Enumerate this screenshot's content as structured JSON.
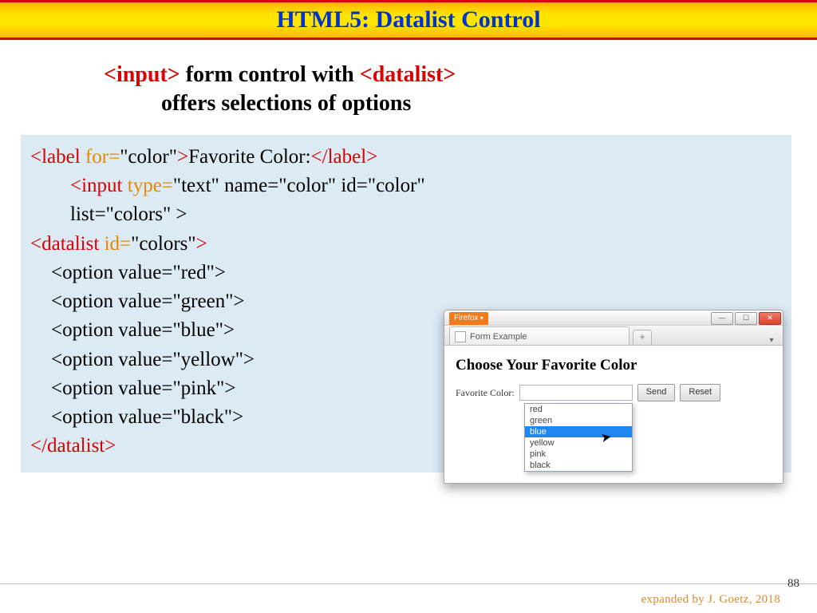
{
  "title": "HTML5: Datalist Control",
  "subtitle": {
    "tag_input": "<input>",
    "middle": " form control with ",
    "tag_datalist": "<datalist>",
    "line2": "offers selections of options"
  },
  "code": {
    "line1": {
      "open": "<label ",
      "attr": "for=",
      "val": "\"color\"",
      "close": ">",
      "text": "Favorite Color:",
      "end": "</label>"
    },
    "line2_a": "<input ",
    "line2_type_key": "type=",
    "line2_type_val": "\"text\"",
    "line2_rest_a": " name=\"color\" id=\"color\" ",
    "line3": "list=\"colors\" >",
    "line4_open": "<datalist ",
    "line4_attr": "id=",
    "line4_val": "\"colors\"",
    "line4_close": ">",
    "options": [
      "<option value=\"red\">",
      "<option value=\"green\">",
      "<option value=\"blue\">",
      "<option value=\"yellow\">",
      "<option value=\"pink\">",
      "<option value=\"black\">"
    ],
    "close_datalist": "</datalist>"
  },
  "browser": {
    "badge": "Firefox",
    "tab_label": "Form Example",
    "heading": "Choose Your Favorite Color",
    "label": "Favorite Color:",
    "send": "Send",
    "reset": "Reset",
    "suggestions": [
      "red",
      "green",
      "blue",
      "yellow",
      "pink",
      "black"
    ],
    "selected_index": 2
  },
  "footer": "expanded  by J. Goetz, 2018",
  "page_number": "88"
}
